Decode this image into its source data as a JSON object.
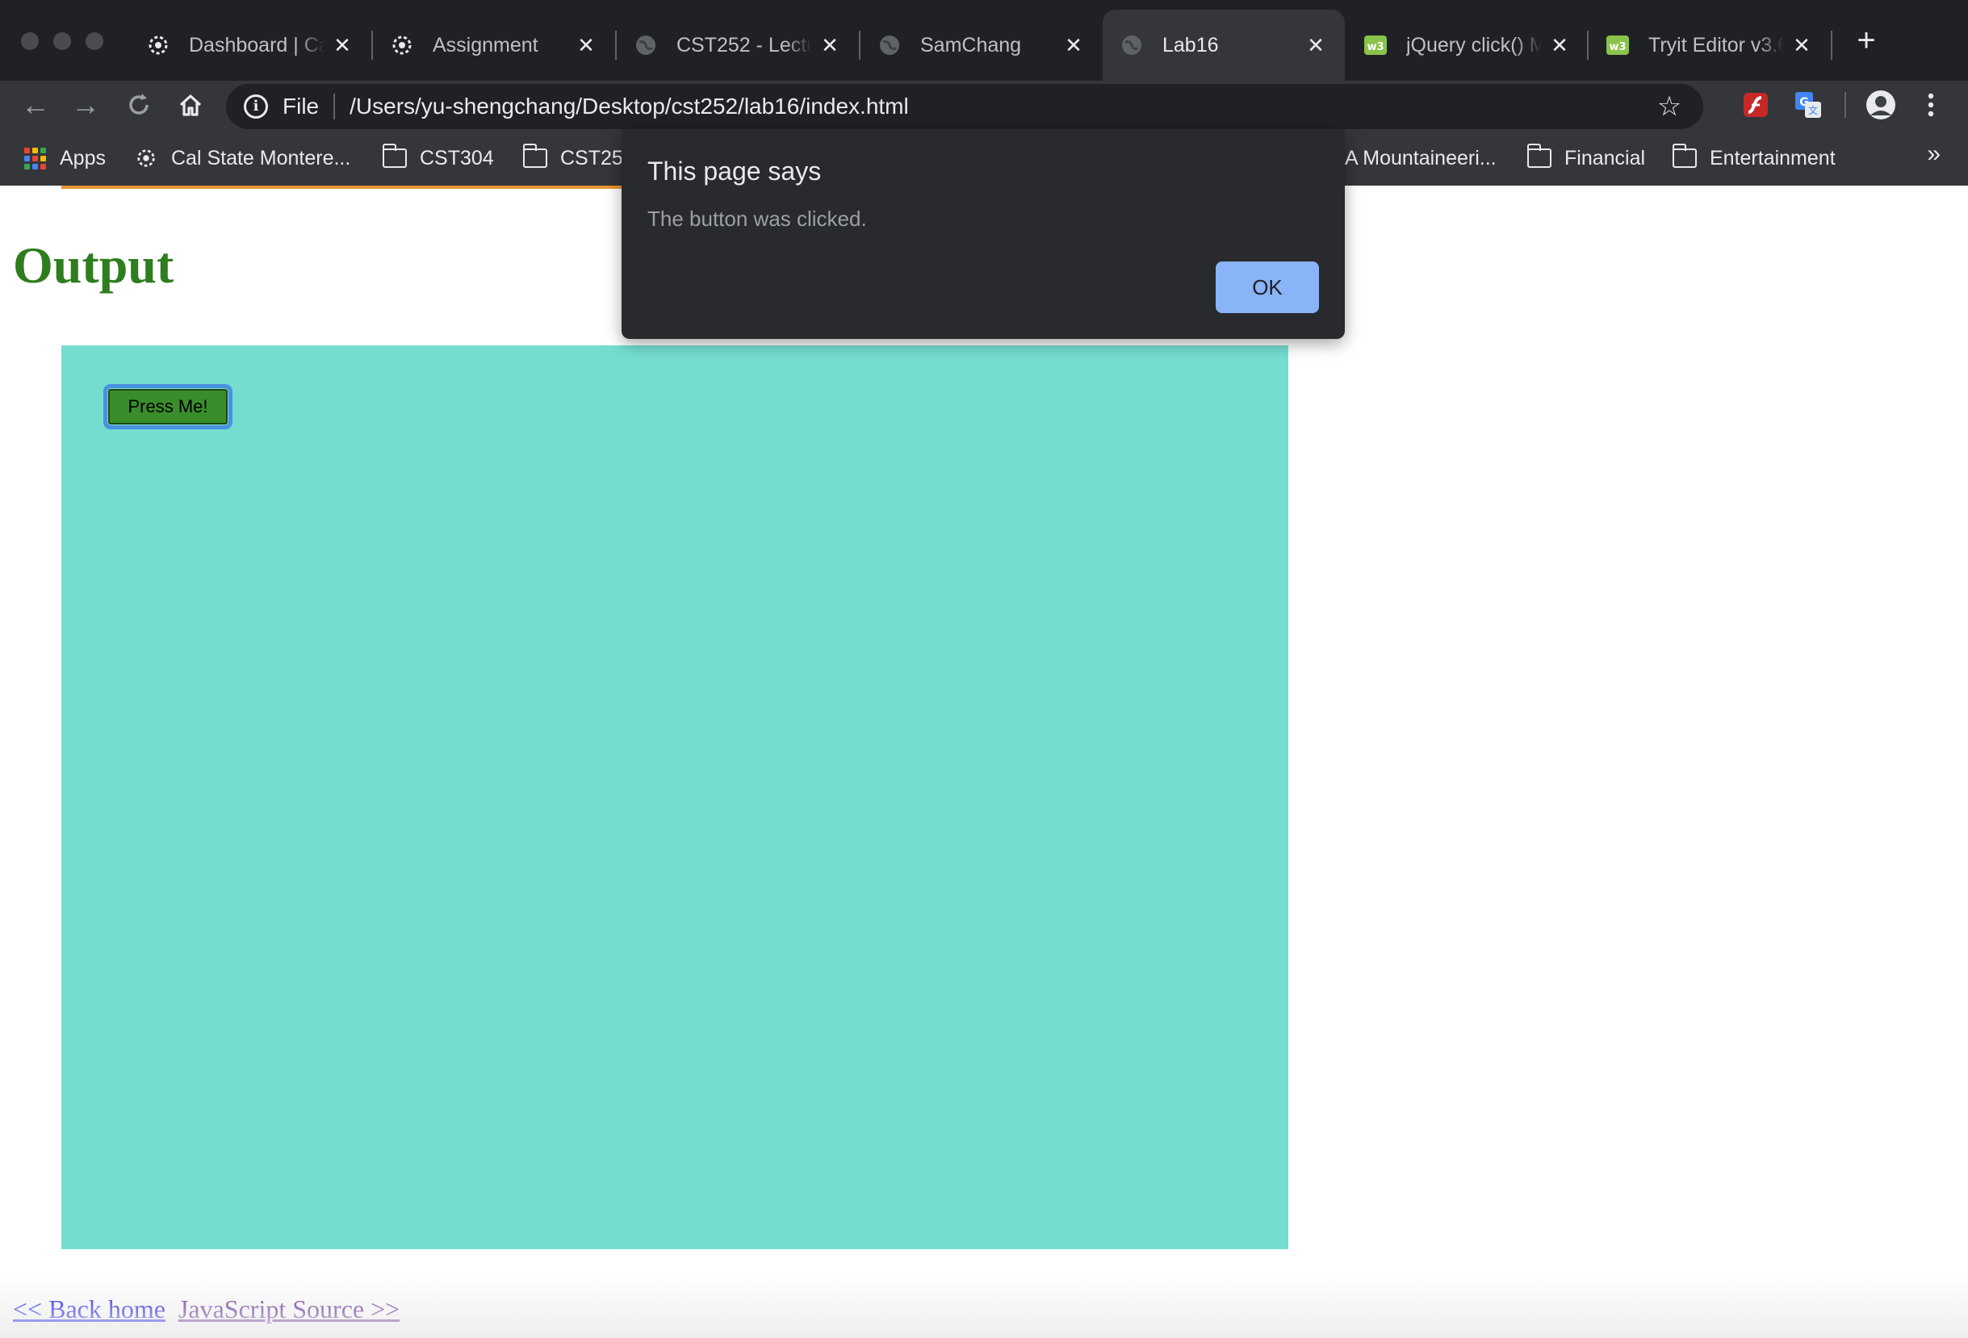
{
  "browser": {
    "tabs": [
      {
        "title": "Dashboard | Ca",
        "favicon": "gear-favicon",
        "active": false
      },
      {
        "title": "Assignment",
        "favicon": "gear-favicon",
        "active": false
      },
      {
        "title": "CST252 - Lectu",
        "favicon": "globe-favicon",
        "active": false
      },
      {
        "title": "SamChang",
        "favicon": "globe-favicon",
        "active": false
      },
      {
        "title": "Lab16",
        "favicon": "globe-favicon",
        "active": true
      },
      {
        "title": "jQuery click() M",
        "favicon": "w3-favicon",
        "active": false
      },
      {
        "title": "Tryit Editor v3.6",
        "favicon": "w3-favicon",
        "active": false
      }
    ],
    "new_tab_label": "+",
    "omnibox": {
      "scheme": "File",
      "url": "/Users/yu-shengchang/Desktop/cst252/lab16/index.html"
    },
    "bookmarks": [
      {
        "label": "Apps",
        "icon": "apps-icon"
      },
      {
        "label": "Cal State Montere...",
        "icon": "gear-favicon"
      },
      {
        "label": "CST304",
        "icon": "folder-icon"
      },
      {
        "label": "CST25",
        "icon": "folder-icon"
      },
      {
        "label": "A Mountaineeri...",
        "icon": "none"
      },
      {
        "label": "Financial",
        "icon": "folder-icon"
      },
      {
        "label": "Entertainment",
        "icon": "folder-icon"
      }
    ],
    "bookmarks_overflow": "»",
    "colors": {
      "chrome_bg": "#35363a",
      "tabstrip_bg": "#202124",
      "omnibox_bg": "#202124",
      "text": "#e8eaed"
    }
  },
  "dialog": {
    "title": "This page says",
    "message": "The button was clicked.",
    "ok_label": "OK",
    "colors": {
      "bg": "#292a2d",
      "button": "#8ab4f8"
    }
  },
  "page": {
    "heading": "Output",
    "button_label": "Press Me!",
    "links": {
      "back": "<< Back home",
      "source": "JavaScript Source >>"
    },
    "colors": {
      "heading": "#2e7d1f",
      "box": "#74ddd0",
      "button": "#3a8d2b",
      "button_focus": "#4a90e2",
      "accent_line": "#e8952f"
    }
  }
}
